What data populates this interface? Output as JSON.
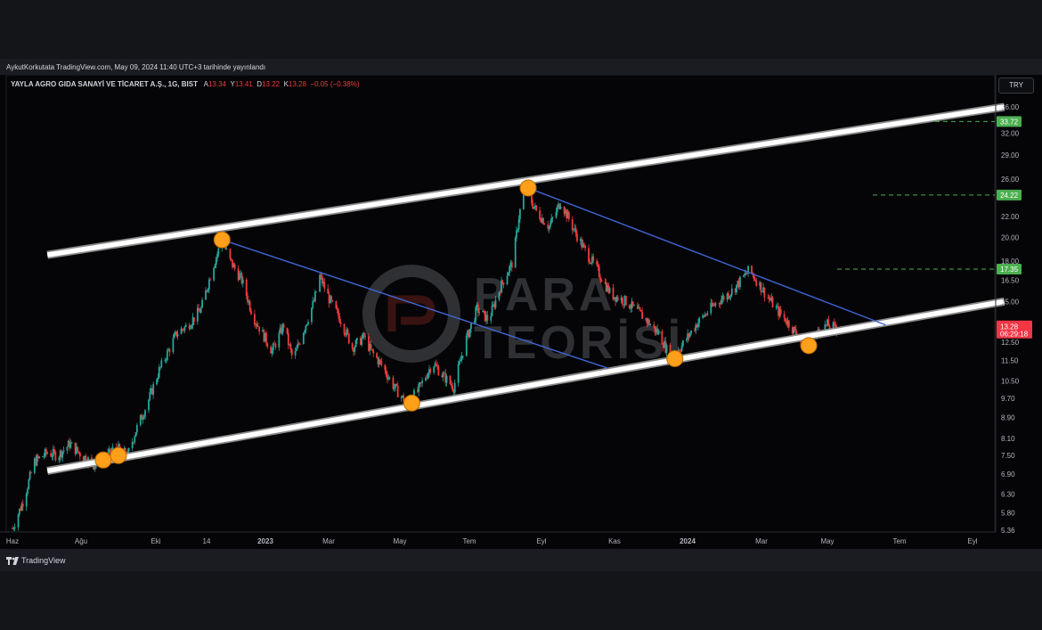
{
  "published_line": "AykutKorkutata TradingView.com, May 09, 2024 11:40 UTC+3 tarihinde yayınlandı",
  "legend": {
    "symbol": "YAYLA AGRO GIDA SANAYİ VE TİCARET A.Ş., 1G, BIST",
    "o_label": "A",
    "o_val": "13.34",
    "h_label": "Y",
    "h_val": "13.41",
    "l_label": "D",
    "l_val": "13.22",
    "c_label": "K",
    "c_val": "13.28",
    "change": "−0.05 (−0.38%)"
  },
  "currency": "TRY",
  "footer_brand": "TradingView",
  "watermark": {
    "line1": "PARA",
    "line2": "TEORİSİ"
  },
  "colors": {
    "up": "#26a69a",
    "down": "#ef3b3b",
    "channel": "#ffffff",
    "trend": "#3f66d6",
    "marker": "#ff9f1a",
    "target": "#4caf50",
    "price_tag": "#f23645"
  },
  "chart_data": {
    "type": "candlestick",
    "scale": "log",
    "y_ticks": [
      "36.00",
      "32.00",
      "29.00",
      "26.00",
      "22.00",
      "20.00",
      "18.00",
      "16.50",
      "15.00",
      "13.50",
      "12.50",
      "11.50",
      "10.50",
      "9.70",
      "8.90",
      "8.10",
      "7.50",
      "6.90",
      "6.30",
      "5.80",
      "5.36"
    ],
    "x_ticks": [
      "Haz",
      "Ağu",
      "Eki",
      "14",
      "2023",
      "Mar",
      "May",
      "Tem",
      "Eyl",
      "Kas",
      "2024",
      "Mar",
      "May",
      "Tem",
      "Eyl"
    ],
    "bold_x_ticks": [
      "2023",
      "2024"
    ],
    "targets": [
      33.72,
      24.22,
      17.35
    ],
    "target_labels": [
      "33.72",
      "24.22",
      "17.35"
    ],
    "last_price": "13.28",
    "countdown": "06:29:18",
    "close_path": [
      [
        "2022-06-01",
        5.4
      ],
      [
        "2022-06-10",
        6.1
      ],
      [
        "2022-06-20",
        7.3
      ],
      [
        "2022-07-01",
        7.6
      ],
      [
        "2022-07-10",
        7.5
      ],
      [
        "2022-07-20",
        7.9
      ],
      [
        "2022-07-28",
        7.6
      ],
      [
        "2022-08-10",
        7.2
      ],
      [
        "2022-08-20",
        7.4
      ],
      [
        "2022-08-28",
        7.8
      ],
      [
        "2022-09-08",
        7.5
      ],
      [
        "2022-09-15",
        8.4
      ],
      [
        "2022-09-25",
        9.5
      ],
      [
        "2022-10-05",
        11.0
      ],
      [
        "2022-10-20",
        13.0
      ],
      [
        "2022-10-30",
        13.5
      ],
      [
        "2022-11-10",
        14.5
      ],
      [
        "2022-11-20",
        17.5
      ],
      [
        "2022-11-28",
        19.8
      ],
      [
        "2022-12-05",
        18.0
      ],
      [
        "2022-12-15",
        16.5
      ],
      [
        "2022-12-25",
        14.0
      ],
      [
        "2023-01-10",
        12.0
      ],
      [
        "2023-01-20",
        13.5
      ],
      [
        "2023-01-28",
        11.5
      ],
      [
        "2023-02-05",
        13.0
      ],
      [
        "2023-02-15",
        15.0
      ],
      [
        "2023-02-20",
        16.8
      ],
      [
        "2023-03-01",
        15.0
      ],
      [
        "2023-03-10",
        13.8
      ],
      [
        "2023-03-20",
        12.2
      ],
      [
        "2023-03-30",
        12.8
      ],
      [
        "2023-04-05",
        12.0
      ],
      [
        "2023-04-15",
        11.2
      ],
      [
        "2023-04-25",
        10.2
      ],
      [
        "2023-05-05",
        9.5
      ],
      [
        "2023-05-15",
        10.0
      ],
      [
        "2023-05-28",
        11.4
      ],
      [
        "2023-06-05",
        10.8
      ],
      [
        "2023-06-15",
        10.2
      ],
      [
        "2023-06-25",
        12.5
      ],
      [
        "2023-07-05",
        14.5
      ],
      [
        "2023-07-15",
        13.8
      ],
      [
        "2023-07-25",
        16.0
      ],
      [
        "2023-08-05",
        18.0
      ],
      [
        "2023-08-10",
        22.0
      ],
      [
        "2023-08-15",
        25.0
      ],
      [
        "2023-08-25",
        22.5
      ],
      [
        "2023-09-05",
        21.0
      ],
      [
        "2023-09-15",
        23.5
      ],
      [
        "2023-09-25",
        21.0
      ],
      [
        "2023-10-05",
        19.0
      ],
      [
        "2023-10-15",
        17.5
      ],
      [
        "2023-10-28",
        15.5
      ],
      [
        "2023-11-10",
        15.0
      ],
      [
        "2023-11-25",
        14.0
      ],
      [
        "2023-12-08",
        13.0
      ],
      [
        "2023-12-18",
        11.7
      ],
      [
        "2023-12-28",
        12.3
      ],
      [
        "2024-01-10",
        13.6
      ],
      [
        "2024-01-25",
        14.8
      ],
      [
        "2024-02-10",
        15.8
      ],
      [
        "2024-02-24",
        17.3
      ],
      [
        "2024-03-05",
        16.0
      ],
      [
        "2024-03-18",
        14.5
      ],
      [
        "2024-03-30",
        13.5
      ],
      [
        "2024-04-10",
        12.4
      ],
      [
        "2024-04-20",
        12.9
      ],
      [
        "2024-05-01",
        13.5
      ],
      [
        "2024-05-09",
        13.28
      ]
    ],
    "channel_upper": [
      [
        "2022-07-01",
        18.5
      ],
      [
        "2024-09-30",
        36.0
      ]
    ],
    "channel_lower": [
      [
        "2022-07-01",
        7.0
      ],
      [
        "2024-09-30",
        15.0
      ]
    ],
    "trendlines": [
      [
        [
          "2022-11-28",
          19.8
        ],
        [
          "2023-10-26",
          11.1
        ]
      ],
      [
        [
          "2023-08-18",
          25.0
        ],
        [
          "2024-06-20",
          13.5
        ]
      ]
    ],
    "touch_points": [
      [
        "2022-08-18",
        7.35
      ],
      [
        "2022-08-31",
        7.5
      ],
      [
        "2022-11-28",
        19.8
      ],
      [
        "2023-05-10",
        9.5
      ],
      [
        "2023-08-18",
        25.0
      ],
      [
        "2023-12-22",
        11.6
      ],
      [
        "2024-04-15",
        12.3
      ]
    ]
  }
}
